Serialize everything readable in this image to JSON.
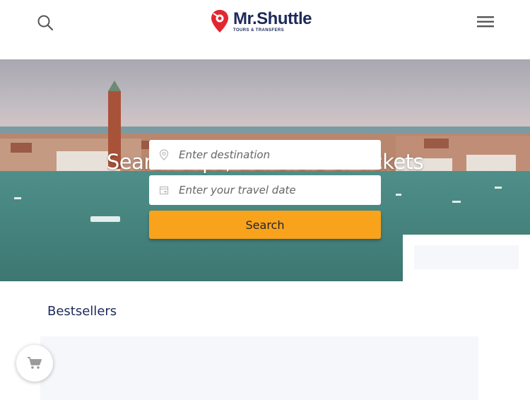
{
  "header": {
    "logo_main": "Mr.Shuttle",
    "logo_sub": "TOURS & TRANSFERS",
    "search_icon": "search-icon",
    "menu_icon": "hamburger-menu-icon"
  },
  "hero": {
    "title": "Search trips, transfers or tickets",
    "destination": {
      "placeholder": "Enter destination",
      "icon": "location-pin-icon"
    },
    "date": {
      "placeholder": "Enter your travel date",
      "icon": "calendar-icon"
    },
    "search_button": "Search"
  },
  "main": {
    "section_title": "Bestsellers"
  },
  "cart": {
    "icon": "shopping-cart-icon"
  },
  "colors": {
    "brand_navy": "#1e2a5a",
    "brand_red": "#e3262f",
    "accent_orange": "#f9a21b"
  }
}
